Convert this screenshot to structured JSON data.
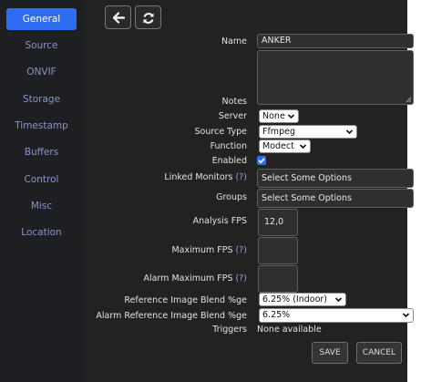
{
  "sidebar": {
    "items": [
      {
        "label": "General",
        "active": true
      },
      {
        "label": "Source"
      },
      {
        "label": "ONVIF"
      },
      {
        "label": "Storage"
      },
      {
        "label": "Timestamp"
      },
      {
        "label": "Buffers"
      },
      {
        "label": "Control"
      },
      {
        "label": "Misc"
      },
      {
        "label": "Location"
      }
    ]
  },
  "toolbar": {
    "back_icon": "arrow-left-icon",
    "refresh_icon": "refresh-icon"
  },
  "form": {
    "name_label": "Name",
    "name_value": "ANKER",
    "notes_label": "Notes",
    "notes_value": "",
    "server_label": "Server",
    "server_value": "None",
    "source_type_label": "Source Type",
    "source_type_value": "Ffmpeg",
    "function_label": "Function",
    "function_value": "Modect",
    "enabled_label": "Enabled",
    "enabled_checked": true,
    "linked_label": "Linked Monitors",
    "linked_help": "(?)",
    "linked_placeholder": "Select Some Options",
    "groups_label": "Groups",
    "groups_placeholder": "Select Some Options",
    "analysis_fps_label": "Analysis FPS",
    "analysis_fps_value": "12,0",
    "max_fps_label": "Maximum FPS",
    "max_fps_help": "(?)",
    "max_fps_value": "",
    "alarm_max_fps_label": "Alarm Maximum FPS",
    "alarm_max_fps_help": "(?)",
    "alarm_max_fps_value": "",
    "ref_blend_label": "Reference Image Blend %ge",
    "ref_blend_value": "6.25% (Indoor)",
    "alarm_ref_blend_label": "Alarm Reference Image Blend %ge",
    "alarm_ref_blend_value": "6.25%",
    "triggers_label": "Triggers",
    "triggers_value": "None available"
  },
  "actions": {
    "save_label": "SAVE",
    "cancel_label": "CANCEL"
  },
  "colors": {
    "accent": "#2f6df0",
    "sidebar_bg": "#1d1f22",
    "main_bg": "#222222",
    "sidebar_text": "#8e93c6"
  }
}
